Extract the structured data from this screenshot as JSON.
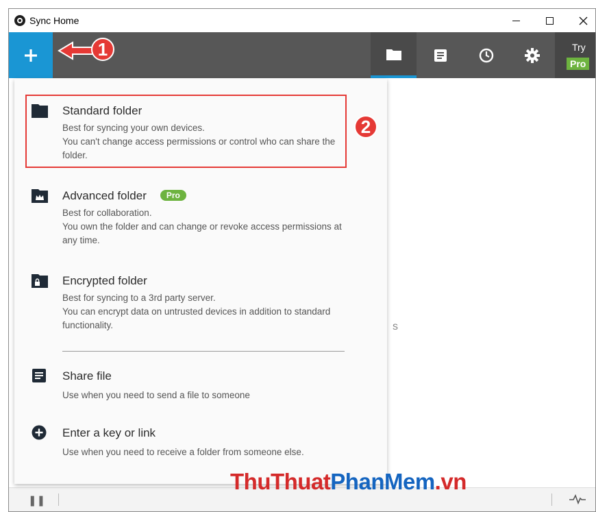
{
  "window": {
    "title": "Sync Home"
  },
  "toolbar": {
    "add_label": "+",
    "try_label": "Try",
    "pro_label": "Pro"
  },
  "annotations": {
    "step1": "1",
    "step2": "2"
  },
  "menu": {
    "items": [
      {
        "title": "Standard folder",
        "desc": [
          "Best for syncing your own devices.",
          "You can't change access permissions or control who can share the folder."
        ],
        "icon": "folder-icon"
      },
      {
        "title": "Advanced folder",
        "badge": "Pro",
        "desc": [
          "Best for collaboration.",
          "You own the folder and can change or revoke access permissions at any time."
        ],
        "icon": "crown-folder-icon"
      },
      {
        "title": "Encrypted folder",
        "desc": [
          "Best for syncing to a 3rd party server.",
          "You can encrypt data on untrusted devices in addition to standard functionality."
        ],
        "icon": "lock-folder-icon"
      },
      {
        "title": "Share file",
        "desc": [
          "Use when you need to send a file to someone"
        ],
        "icon": "file-icon"
      },
      {
        "title": "Enter a key or link",
        "desc": [
          "Use when you need to receive a folder from someone else."
        ],
        "icon": "plus-circle-icon"
      }
    ]
  },
  "background_text": "s",
  "watermark": {
    "part1": "ThuThuat",
    "part2": "PhanMem",
    "part3": ".vn"
  },
  "colors": {
    "accent": "#1a96d4",
    "toolbar": "#575757",
    "pro": "#6db33f",
    "annotation": "#e53935"
  }
}
